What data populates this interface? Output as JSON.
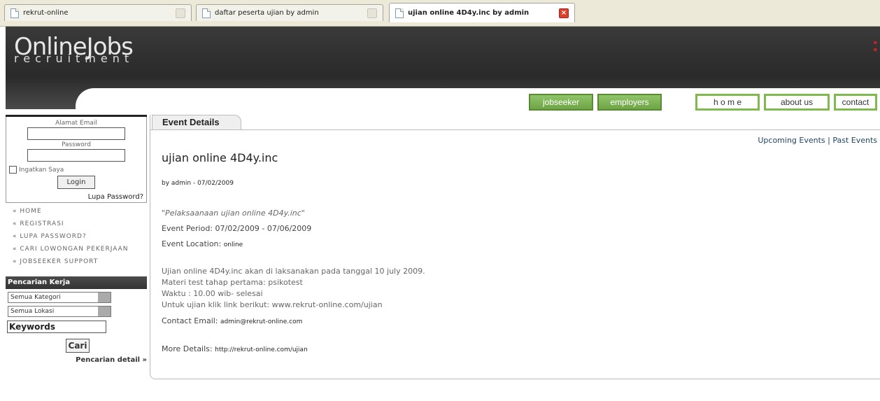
{
  "tabs": [
    {
      "label": "rekrut-online"
    },
    {
      "label": "daftar peserta ujian by admin"
    },
    {
      "label": "ujian online 4D4y.inc by admin"
    }
  ],
  "logo": {
    "big": "OnlineJobs",
    "small": "recruitment"
  },
  "nav": {
    "jobseeker": "jobseeker",
    "employers": "employers",
    "home": "h o m e",
    "about": "about us",
    "contact": "contact"
  },
  "login": {
    "email_label": "Alamat Email",
    "password_label": "Password",
    "remember": "Ingatkan Saya",
    "button": "Login",
    "forgot": "Lupa Password?"
  },
  "menu": [
    "« HOME",
    "« REGISTRASI",
    "« LUPA PASSWORD?",
    "« CARI LOWONGAN PEKERJAAN",
    "« JOBSEEKER SUPPORT"
  ],
  "search": {
    "title": "Pencarian Kerja",
    "category": "Semua Kategori",
    "location": "Semua Lokasi",
    "keywords": "Keywords",
    "button": "Cari",
    "detail": "Pencarian detail »"
  },
  "main": {
    "tab": "Event Details",
    "upcoming": "Upcoming Events | Past Events",
    "title": "ujian online 4D4y.inc",
    "byline": "by admin - 07/02/2009",
    "quote": "\"Pelaksaanaan ujian online 4D4y.inc\"",
    "period_label": "Event Period:",
    "period_value": "07/02/2009 - 07/06/2009",
    "location_label": "Event Location:",
    "location_value": "online",
    "desc": [
      "Ujian online 4D4y.inc akan di laksanakan pada tanggal 10 july 2009.",
      "Materi test tahap pertama: psikotest",
      "Waktu : 10.00 wib- selesai",
      "Untuk ujian klik link berikut: www.rekrut-online.com/ujian"
    ],
    "contact_label": "Contact Email:",
    "contact_value": "admin@rekrut-online.com",
    "more_label": "More Details:",
    "more_value": "http://rekrut-online.com/ujian"
  }
}
